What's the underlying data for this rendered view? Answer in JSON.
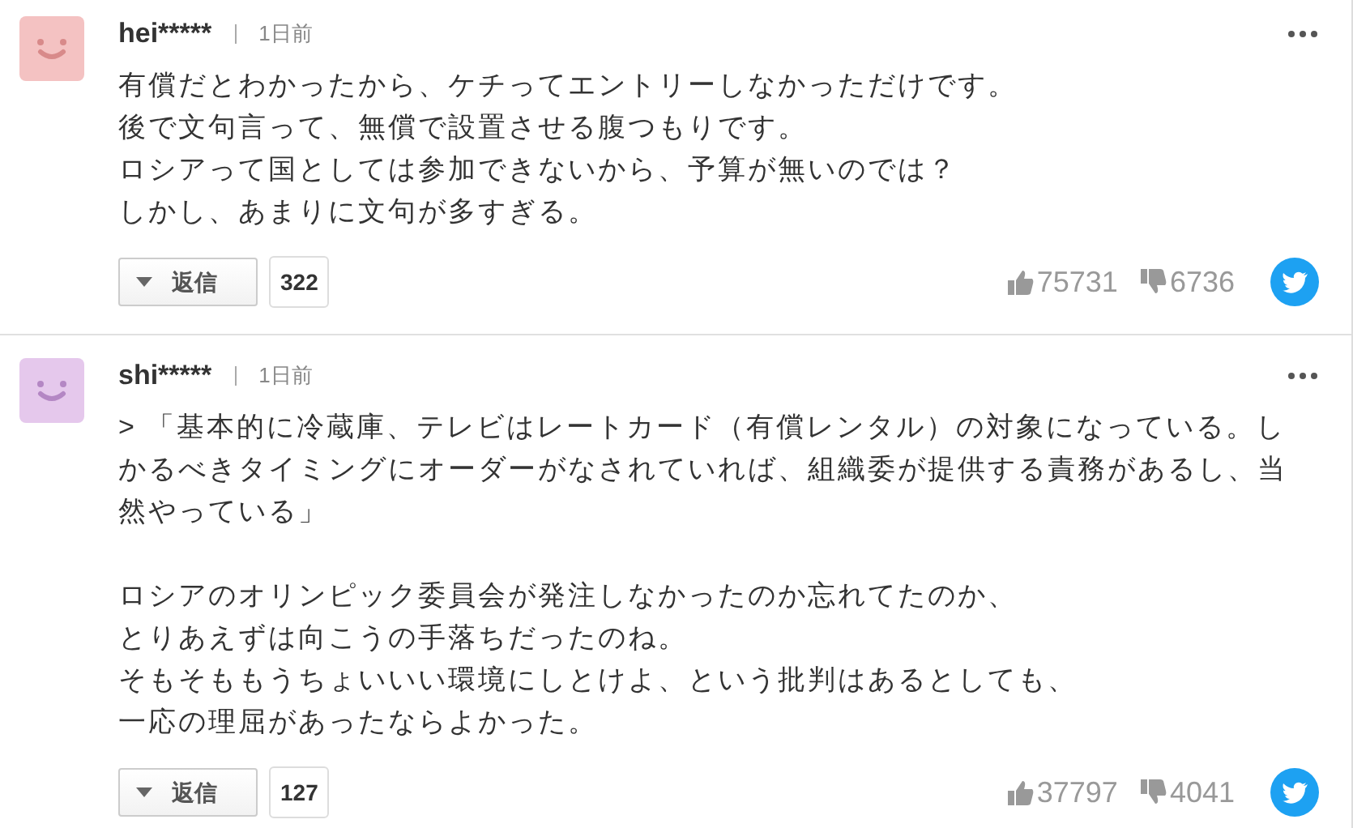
{
  "comments": [
    {
      "user": "hei*****",
      "time": "1日前",
      "color": "#f4c2c2",
      "paragraphs": [
        [
          "有償だとわかったから、ケチってエントリーしなかっただけです。",
          "後で文句言って、無償で設置させる腹つもりです。",
          "ロシアって国としては参加できないから、予算が無いのでは？",
          "しかし、あまりに文句が多すぎる。"
        ]
      ],
      "reply_label": "返信",
      "reply_count": "322",
      "likes": "75731",
      "dislikes": "6736"
    },
    {
      "user": "shi*****",
      "time": "1日前",
      "color": "#e5c8ec",
      "paragraphs": [
        [
          "> 「基本的に冷蔵庫、テレビはレートカード（有償レンタル）の対象になっている。し",
          "かるべきタイミングにオーダーがなされていれば、組織委が提供する責務があるし、当",
          "然やっている」"
        ],
        [
          "ロシアのオリンピック委員会が発注しなかったのか忘れてたのか、",
          "とりあえずは向こうの手落ちだったのね。",
          "そもそももうちょいいい環境にしとけよ、という批判はあるとしても、",
          "一応の理屈があったならよかった。"
        ]
      ],
      "reply_label": "返信",
      "reply_count": "127",
      "likes": "37797",
      "dislikes": "4041"
    }
  ]
}
